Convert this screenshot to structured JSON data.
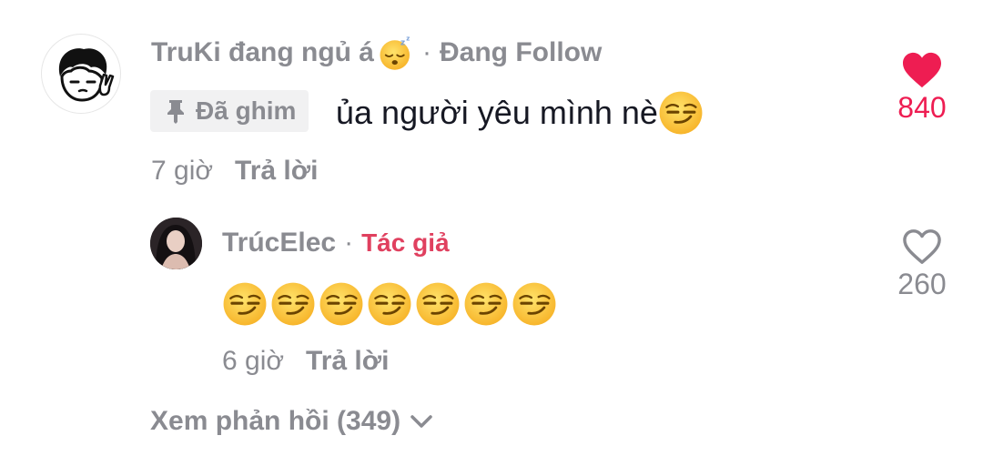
{
  "comment": {
    "username": "TruKi đang ngủ á",
    "username_emoji": "sleeping-face",
    "separator": "·",
    "follow_status": "Đang Follow",
    "pinned_label": "Đã ghim",
    "text": "ủa người yêu mình nè",
    "text_emoji": "smirking-face",
    "time": "7 giờ",
    "reply_label": "Trả lời",
    "like_count": "840",
    "liked": true,
    "like_color": "#ee1d52"
  },
  "reply": {
    "username": "TrúcElec",
    "separator": "·",
    "author_tag": "Tác giả",
    "author_tag_color": "#e0405f",
    "emojis": [
      "smirking-face",
      "smirking-face",
      "smirking-face",
      "smirking-face",
      "smirking-face",
      "smirking-face",
      "smirking-face"
    ],
    "time": "6 giờ",
    "reply_label": "Trả lời",
    "like_count": "260",
    "liked": false
  },
  "view_replies_label": "Xem phản hồi (349)",
  "colors": {
    "muted_text": "#8a8b91",
    "primary_text": "#161823",
    "accent": "#ee1d52",
    "pinned_bg": "#f1f1f2"
  }
}
